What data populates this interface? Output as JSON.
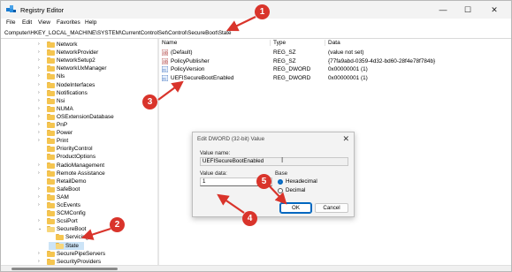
{
  "window": {
    "title": "Registry Editor",
    "controls": {
      "minimize": "—",
      "maximize": "☐",
      "close": "✕"
    }
  },
  "menu": [
    "File",
    "Edit",
    "View",
    "Favorites",
    "Help"
  ],
  "address": "Computer\\HKEY_LOCAL_MACHINE\\SYSTEM\\CurrentControlSet\\Control\\SecureBoot\\State",
  "tree": [
    {
      "label": "Network",
      "expandable": true
    },
    {
      "label": "NetworkProvider",
      "expandable": true
    },
    {
      "label": "NetworkSetup2",
      "expandable": true
    },
    {
      "label": "NetworkUxManager",
      "expandable": true
    },
    {
      "label": "Nls",
      "expandable": true
    },
    {
      "label": "NodeInterfaces",
      "expandable": true
    },
    {
      "label": "Notifications",
      "expandable": true
    },
    {
      "label": "Nsi",
      "expandable": true
    },
    {
      "label": "NUMA",
      "expandable": true
    },
    {
      "label": "OSExtensionDatabase",
      "expandable": true
    },
    {
      "label": "PnP",
      "expandable": true
    },
    {
      "label": "Power",
      "expandable": true
    },
    {
      "label": "Print",
      "expandable": true
    },
    {
      "label": "PriorityControl",
      "expandable": false
    },
    {
      "label": "ProductOptions",
      "expandable": false
    },
    {
      "label": "RadioManagement",
      "expandable": true
    },
    {
      "label": "Remote Assistance",
      "expandable": true
    },
    {
      "label": "RetailDemo",
      "expandable": false
    },
    {
      "label": "SafeBoot",
      "expandable": true
    },
    {
      "label": "SAM",
      "expandable": true
    },
    {
      "label": "ScEvents",
      "expandable": true
    },
    {
      "label": "SCMConfig",
      "expandable": false
    },
    {
      "label": "ScsiPort",
      "expandable": true
    },
    {
      "label": "SecureBoot",
      "expandable": true,
      "expanded": true
    },
    {
      "label": "Servicing",
      "expandable": false,
      "child": true
    },
    {
      "label": "State",
      "expandable": false,
      "child": true,
      "selected": true
    },
    {
      "label": "SecurePipeServers",
      "expandable": true
    },
    {
      "label": "SecurityProviders",
      "expandable": true
    }
  ],
  "columns": {
    "name": "Name",
    "type": "Type",
    "data": "Data"
  },
  "values": [
    {
      "name": "(Default)",
      "type": "REG_SZ",
      "data": "(value not set)",
      "icon": "string-value-icon"
    },
    {
      "name": "PolicyPublisher",
      "type": "REG_SZ",
      "data": "{77fa9abd-0359-4d32-bd60-28f4e78f784b}",
      "icon": "string-value-icon"
    },
    {
      "name": "PolicyVersion",
      "type": "REG_DWORD",
      "data": "0x00000001 (1)",
      "icon": "dword-value-icon"
    },
    {
      "name": "UEFISecureBootEnabled",
      "type": "REG_DWORD",
      "data": "0x00000001 (1)",
      "icon": "dword-value-icon"
    }
  ],
  "dialog": {
    "title": "Edit DWORD (32-bit) Value",
    "close": "✕",
    "value_name_label": "Value name:",
    "value_name": "UEFISecureBootEnabled",
    "value_data_label": "Value data:",
    "value_data": "1",
    "base_label": "Base",
    "base_options": [
      {
        "label": "Hexadecimal",
        "checked": true
      },
      {
        "label": "Decimal",
        "checked": false
      }
    ],
    "ok_label": "OK",
    "cancel_label": "Cancel"
  },
  "annotations": {
    "color": "#d9342b",
    "badges": [
      "1",
      "2",
      "3",
      "4",
      "5"
    ]
  }
}
